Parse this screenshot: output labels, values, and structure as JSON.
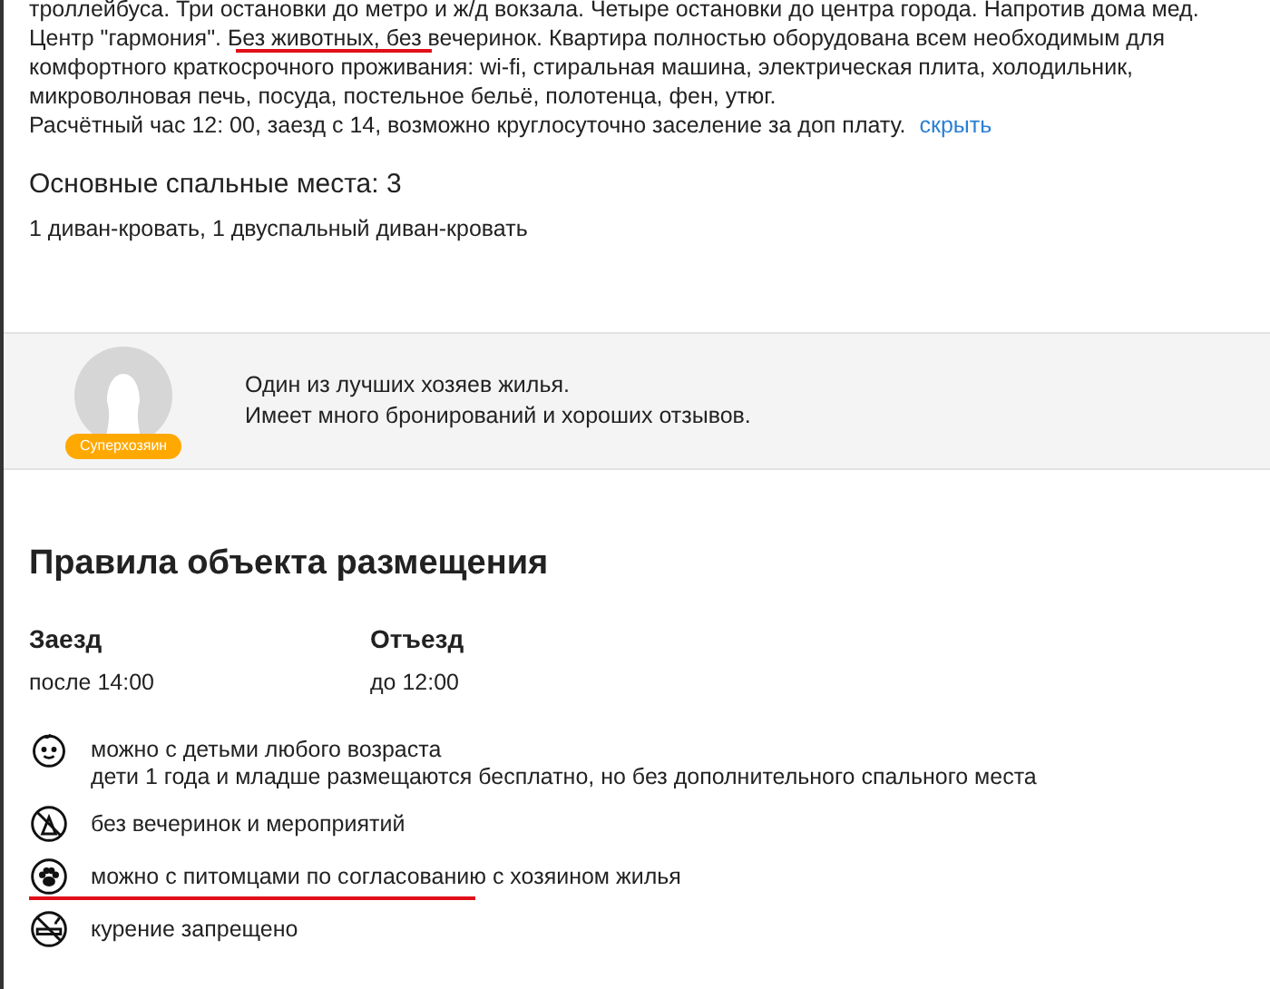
{
  "description": {
    "lines": [
      "троллейбуса. Три остановки до метро и ж/д вокзала. Четыре остановки до центра города. Напротив дома мед.",
      "Центр \"гармония\". Без животных, без вечеринок. Квартира полностью оборудована всем необходимым для",
      "комфортного краткосрочного проживания: wi-fi, стиральная машина, электрическая плита, холодильник,",
      "микроволновая печь, посуда, постельное бельё, полотенца, фен, утюг.",
      "Расчётный час 12: 00, заезд с 14, возможно круглосуточно заселение за доп плату."
    ],
    "link": "скрыть"
  },
  "sleeping": {
    "title": "Основные спальные места: 3",
    "details": "1 диван-кровать, 1 двуспальный диван-кровать"
  },
  "host": {
    "badge": "Суперхозяин",
    "lines": [
      "Один из лучших хозяев жилья.",
      "Имеет много бронирований и хороших отзывов."
    ]
  },
  "rules": {
    "title": "Правила объекта размещения",
    "checkin": {
      "label": "Заезд",
      "value": "после 14:00"
    },
    "checkout": {
      "label": "Отъезд",
      "value": "до 12:00"
    },
    "items": [
      {
        "kind": "kids",
        "lines": [
          "можно с детьми любого возраста",
          "дети 1 года и младше размещаются бесплатно, но без дополнительного спального места"
        ],
        "underlined": false
      },
      {
        "kind": "no-party",
        "lines": [
          "без вечеринок и мероприятий"
        ],
        "underlined": false
      },
      {
        "kind": "pets",
        "lines": [
          "можно с питомцами по согласованию с хозяином жилья"
        ],
        "underlined": true
      },
      {
        "kind": "no-smoking",
        "lines": [
          "курение запрещено"
        ],
        "underlined": false
      }
    ]
  }
}
